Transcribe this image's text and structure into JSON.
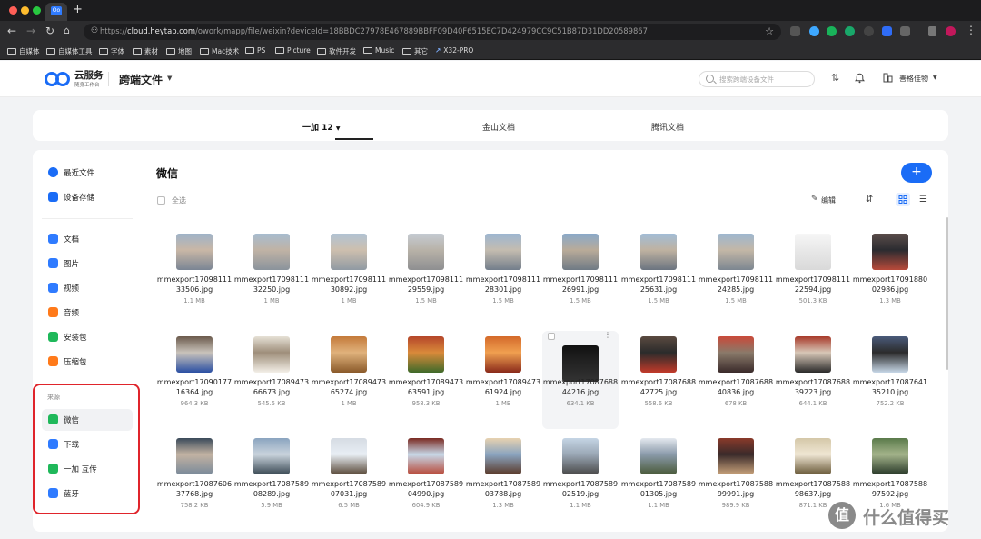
{
  "browser": {
    "url_prefix": "https://",
    "url_host": "cloud.heytap.com",
    "url_path": "/owork/mapp/file/weixin?deviceId=18BBDC27978E467889BBFF09D40F6515EC7D424979CC9C51B87D31DD20589867",
    "tab_favicon_text": "Oo",
    "bookmarks": [
      "自媒体",
      "自媒体工具",
      "字体",
      "素材",
      "地图",
      "Mac技术",
      "PS",
      "Picture",
      "软件开发",
      "Music",
      "其它",
      "X32-PRO"
    ]
  },
  "header": {
    "logo_name": "云服务",
    "logo_sub": "随身工作台",
    "title": "跨端文件",
    "search_placeholder": "搜索跨端设备文件",
    "user_name": "善格佳物"
  },
  "device_tabs": [
    {
      "label": "一加 12"
    },
    {
      "label": "金山文档"
    },
    {
      "label": "腾讯文档"
    }
  ],
  "sidebar": {
    "top_items": [
      {
        "label": "最近文件"
      },
      {
        "label": "设备存储"
      }
    ],
    "type_items": [
      {
        "label": "文档"
      },
      {
        "label": "图片"
      },
      {
        "label": "视频"
      },
      {
        "label": "音频"
      },
      {
        "label": "安装包"
      },
      {
        "label": "压缩包"
      }
    ],
    "source_title": "来源",
    "source_items": [
      {
        "label": "微信"
      },
      {
        "label": "下载"
      },
      {
        "label": "一加 互传"
      },
      {
        "label": "蓝牙"
      }
    ]
  },
  "content": {
    "title": "微信",
    "select_all": "全选",
    "edit": "编辑",
    "add_symbol": "+"
  },
  "files": [
    {
      "name": "mmexport1709811133506.jpg",
      "size": "1.1 MB"
    },
    {
      "name": "mmexport1709811132250.jpg",
      "size": "1 MB"
    },
    {
      "name": "mmexport1709811130892.jpg",
      "size": "1 MB"
    },
    {
      "name": "mmexport1709811129559.jpg",
      "size": "1.5 MB"
    },
    {
      "name": "mmexport1709811128301.jpg",
      "size": "1.5 MB"
    },
    {
      "name": "mmexport1709811126991.jpg",
      "size": "1.5 MB"
    },
    {
      "name": "mmexport1709811125631.jpg",
      "size": "1.5 MB"
    },
    {
      "name": "mmexport1709811124285.jpg",
      "size": "1.5 MB"
    },
    {
      "name": "mmexport1709811122594.jpg",
      "size": "501.3 KB"
    },
    {
      "name": "mmexport1709188002986.jpg",
      "size": "1.3 MB"
    },
    {
      "name": "mmexport1709017716364.jpg",
      "size": "964.3 KB"
    },
    {
      "name": "mmexport1708947366673.jpg",
      "size": "545.5 KB"
    },
    {
      "name": "mmexport1708947365274.jpg",
      "size": "1 MB"
    },
    {
      "name": "mmexport1708947363591.jpg",
      "size": "958.3 KB"
    },
    {
      "name": "mmexport1708947361924.jpg",
      "size": "1 MB"
    },
    {
      "name": "mmexport1708768844216.jpg",
      "size": "634.1 KB"
    },
    {
      "name": "mmexport1708768842725.jpg",
      "size": "558.6 KB"
    },
    {
      "name": "mmexport1708768840836.jpg",
      "size": "678 KB"
    },
    {
      "name": "mmexport1708768839223.jpg",
      "size": "644.1 KB"
    },
    {
      "name": "mmexport1708764135210.jpg",
      "size": "752.2 KB"
    },
    {
      "name": "mmexport1708760637768.jpg",
      "size": "758.2 KB"
    },
    {
      "name": "mmexport1708758908289.jpg",
      "size": "5.9 MB"
    },
    {
      "name": "mmexport1708758907031.jpg",
      "size": "6.5 MB"
    },
    {
      "name": "mmexport1708758904990.jpg",
      "size": "604.9 KB"
    },
    {
      "name": "mmexport1708758903788.jpg",
      "size": "1.3 MB"
    },
    {
      "name": "mmexport1708758902519.jpg",
      "size": "1.1 MB"
    },
    {
      "name": "mmexport1708758901305.jpg",
      "size": "1.1 MB"
    },
    {
      "name": "mmexport1708758899991.jpg",
      "size": "989.9 KB"
    },
    {
      "name": "mmexport1708758898637.jpg",
      "size": "871.1 KB"
    },
    {
      "name": "mmexport1708758897592.jpg",
      "size": "1.6 MB"
    }
  ],
  "watermark": {
    "symbol": "值",
    "text": "什么值得买"
  },
  "colors": {
    "accent": "#1a6cf6",
    "highlight": "#e0242b"
  }
}
